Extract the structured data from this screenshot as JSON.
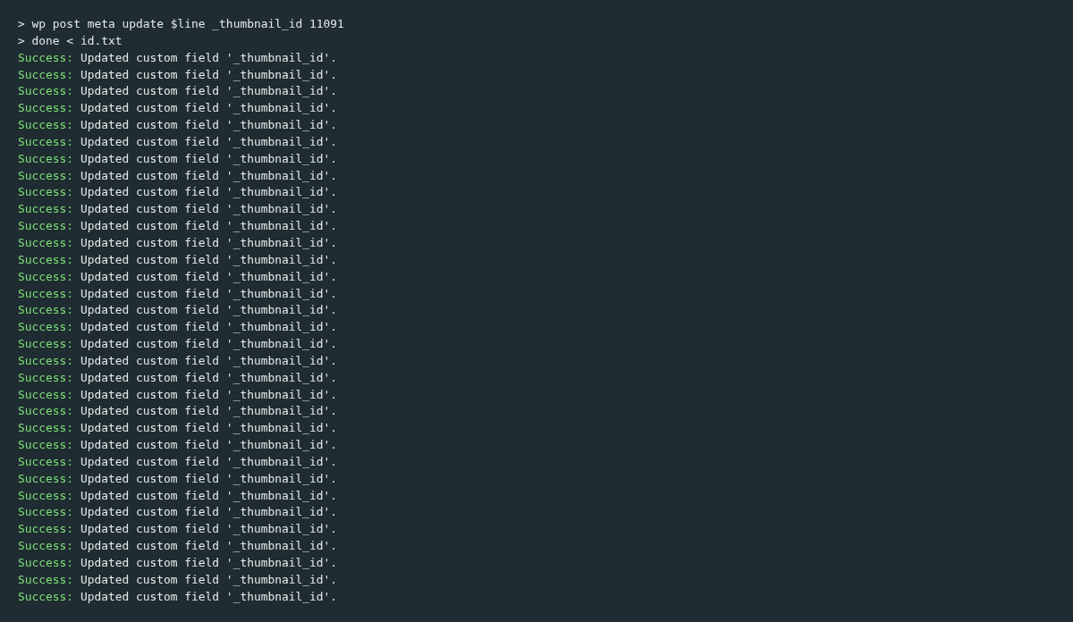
{
  "terminal": {
    "lines": [
      {
        "kind": "command",
        "prompt": ">",
        "text": "wp post meta update $line _thumbnail_id 11091"
      },
      {
        "kind": "command",
        "prompt": ">",
        "text": "done < id.txt"
      },
      {
        "kind": "success",
        "label": "Success:",
        "text": "Updated custom field '_thumbnail_id'."
      },
      {
        "kind": "success",
        "label": "Success:",
        "text": "Updated custom field '_thumbnail_id'."
      },
      {
        "kind": "success",
        "label": "Success:",
        "text": "Updated custom field '_thumbnail_id'."
      },
      {
        "kind": "success",
        "label": "Success:",
        "text": "Updated custom field '_thumbnail_id'."
      },
      {
        "kind": "success",
        "label": "Success:",
        "text": "Updated custom field '_thumbnail_id'."
      },
      {
        "kind": "success",
        "label": "Success:",
        "text": "Updated custom field '_thumbnail_id'."
      },
      {
        "kind": "success",
        "label": "Success:",
        "text": "Updated custom field '_thumbnail_id'."
      },
      {
        "kind": "success",
        "label": "Success:",
        "text": "Updated custom field '_thumbnail_id'."
      },
      {
        "kind": "success",
        "label": "Success:",
        "text": "Updated custom field '_thumbnail_id'."
      },
      {
        "kind": "success",
        "label": "Success:",
        "text": "Updated custom field '_thumbnail_id'."
      },
      {
        "kind": "success",
        "label": "Success:",
        "text": "Updated custom field '_thumbnail_id'."
      },
      {
        "kind": "success",
        "label": "Success:",
        "text": "Updated custom field '_thumbnail_id'."
      },
      {
        "kind": "success",
        "label": "Success:",
        "text": "Updated custom field '_thumbnail_id'."
      },
      {
        "kind": "success",
        "label": "Success:",
        "text": "Updated custom field '_thumbnail_id'."
      },
      {
        "kind": "success",
        "label": "Success:",
        "text": "Updated custom field '_thumbnail_id'."
      },
      {
        "kind": "success",
        "label": "Success:",
        "text": "Updated custom field '_thumbnail_id'."
      },
      {
        "kind": "success",
        "label": "Success:",
        "text": "Updated custom field '_thumbnail_id'."
      },
      {
        "kind": "success",
        "label": "Success:",
        "text": "Updated custom field '_thumbnail_id'."
      },
      {
        "kind": "success",
        "label": "Success:",
        "text": "Updated custom field '_thumbnail_id'."
      },
      {
        "kind": "success",
        "label": "Success:",
        "text": "Updated custom field '_thumbnail_id'."
      },
      {
        "kind": "success",
        "label": "Success:",
        "text": "Updated custom field '_thumbnail_id'."
      },
      {
        "kind": "success",
        "label": "Success:",
        "text": "Updated custom field '_thumbnail_id'."
      },
      {
        "kind": "success",
        "label": "Success:",
        "text": "Updated custom field '_thumbnail_id'."
      },
      {
        "kind": "success",
        "label": "Success:",
        "text": "Updated custom field '_thumbnail_id'."
      },
      {
        "kind": "success",
        "label": "Success:",
        "text": "Updated custom field '_thumbnail_id'."
      },
      {
        "kind": "success",
        "label": "Success:",
        "text": "Updated custom field '_thumbnail_id'."
      },
      {
        "kind": "success",
        "label": "Success:",
        "text": "Updated custom field '_thumbnail_id'."
      },
      {
        "kind": "success",
        "label": "Success:",
        "text": "Updated custom field '_thumbnail_id'."
      },
      {
        "kind": "success",
        "label": "Success:",
        "text": "Updated custom field '_thumbnail_id'."
      },
      {
        "kind": "success",
        "label": "Success:",
        "text": "Updated custom field '_thumbnail_id'."
      },
      {
        "kind": "success",
        "label": "Success:",
        "text": "Updated custom field '_thumbnail_id'."
      },
      {
        "kind": "success",
        "label": "Success:",
        "text": "Updated custom field '_thumbnail_id'."
      },
      {
        "kind": "success",
        "label": "Success:",
        "text": "Updated custom field '_thumbnail_id'."
      }
    ]
  }
}
